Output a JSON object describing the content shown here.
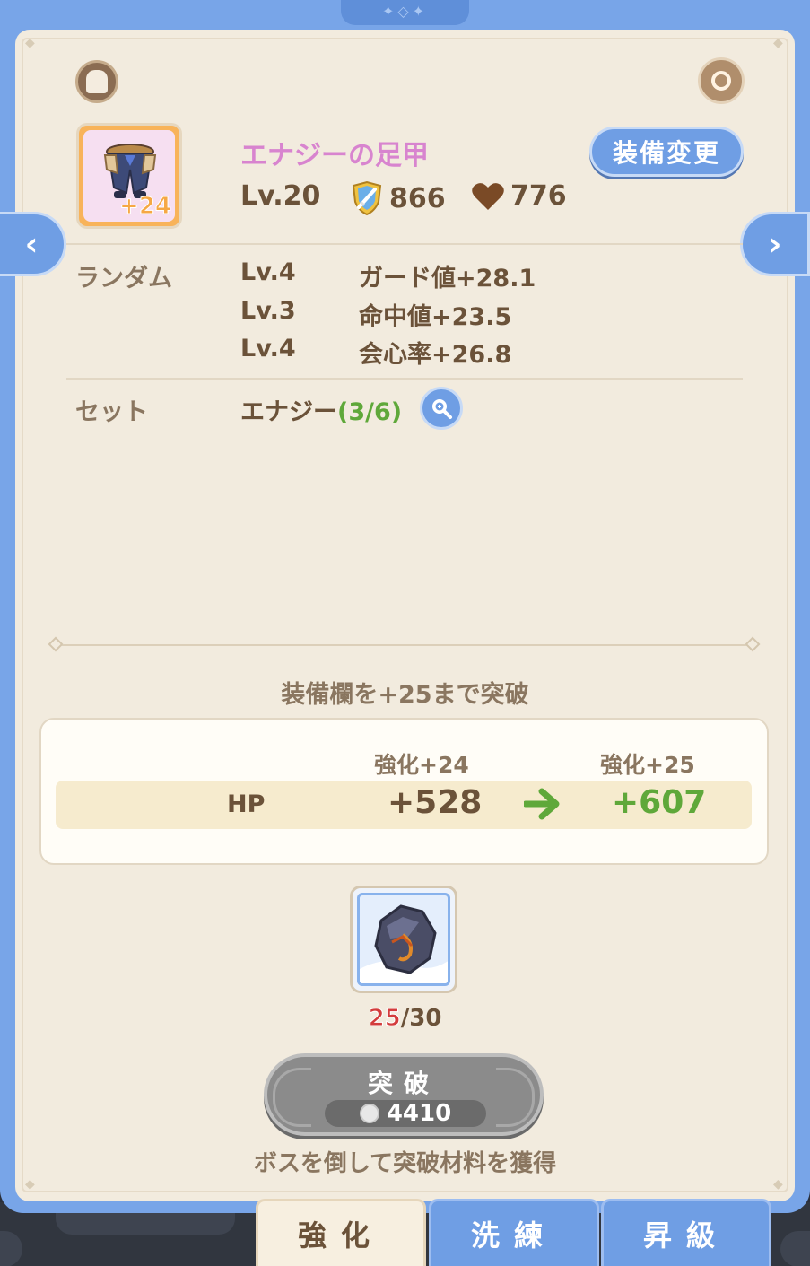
{
  "item": {
    "name": "エナジーの足甲",
    "plus": "+24",
    "level": "Lv.20",
    "attack": "866",
    "hp": "776"
  },
  "equip_button_label": "装備変更",
  "random": {
    "label": "ランダム",
    "rows": [
      {
        "lv": "Lv.4",
        "value": "ガード値+28.1"
      },
      {
        "lv": "Lv.3",
        "value": "命中値+23.5"
      },
      {
        "lv": "Lv.4",
        "value": "会心率+26.8"
      }
    ]
  },
  "set": {
    "label": "セット",
    "name": "エナジー",
    "count": "(3/6)"
  },
  "breakthrough": {
    "title": "装備欄を+25まで突破",
    "current_header": "強化+24",
    "next_header": "強化+25",
    "stat": "HP",
    "current_value": "+528",
    "next_value": "+607",
    "material_have": "25",
    "material_need": "/30",
    "button_label": "突破",
    "cost": "4410",
    "hint": "ボスを倒して突破材料を獲得"
  },
  "tabs": [
    {
      "label": "強化",
      "active": true
    },
    {
      "label": "洗練",
      "active": false
    },
    {
      "label": "昇級",
      "active": false
    }
  ],
  "colors": {
    "frame": "#78a5e8",
    "card": "#f2ebde",
    "name": "#d884cf",
    "positive": "#5fa83a",
    "insufficient": "#d33c3c"
  }
}
